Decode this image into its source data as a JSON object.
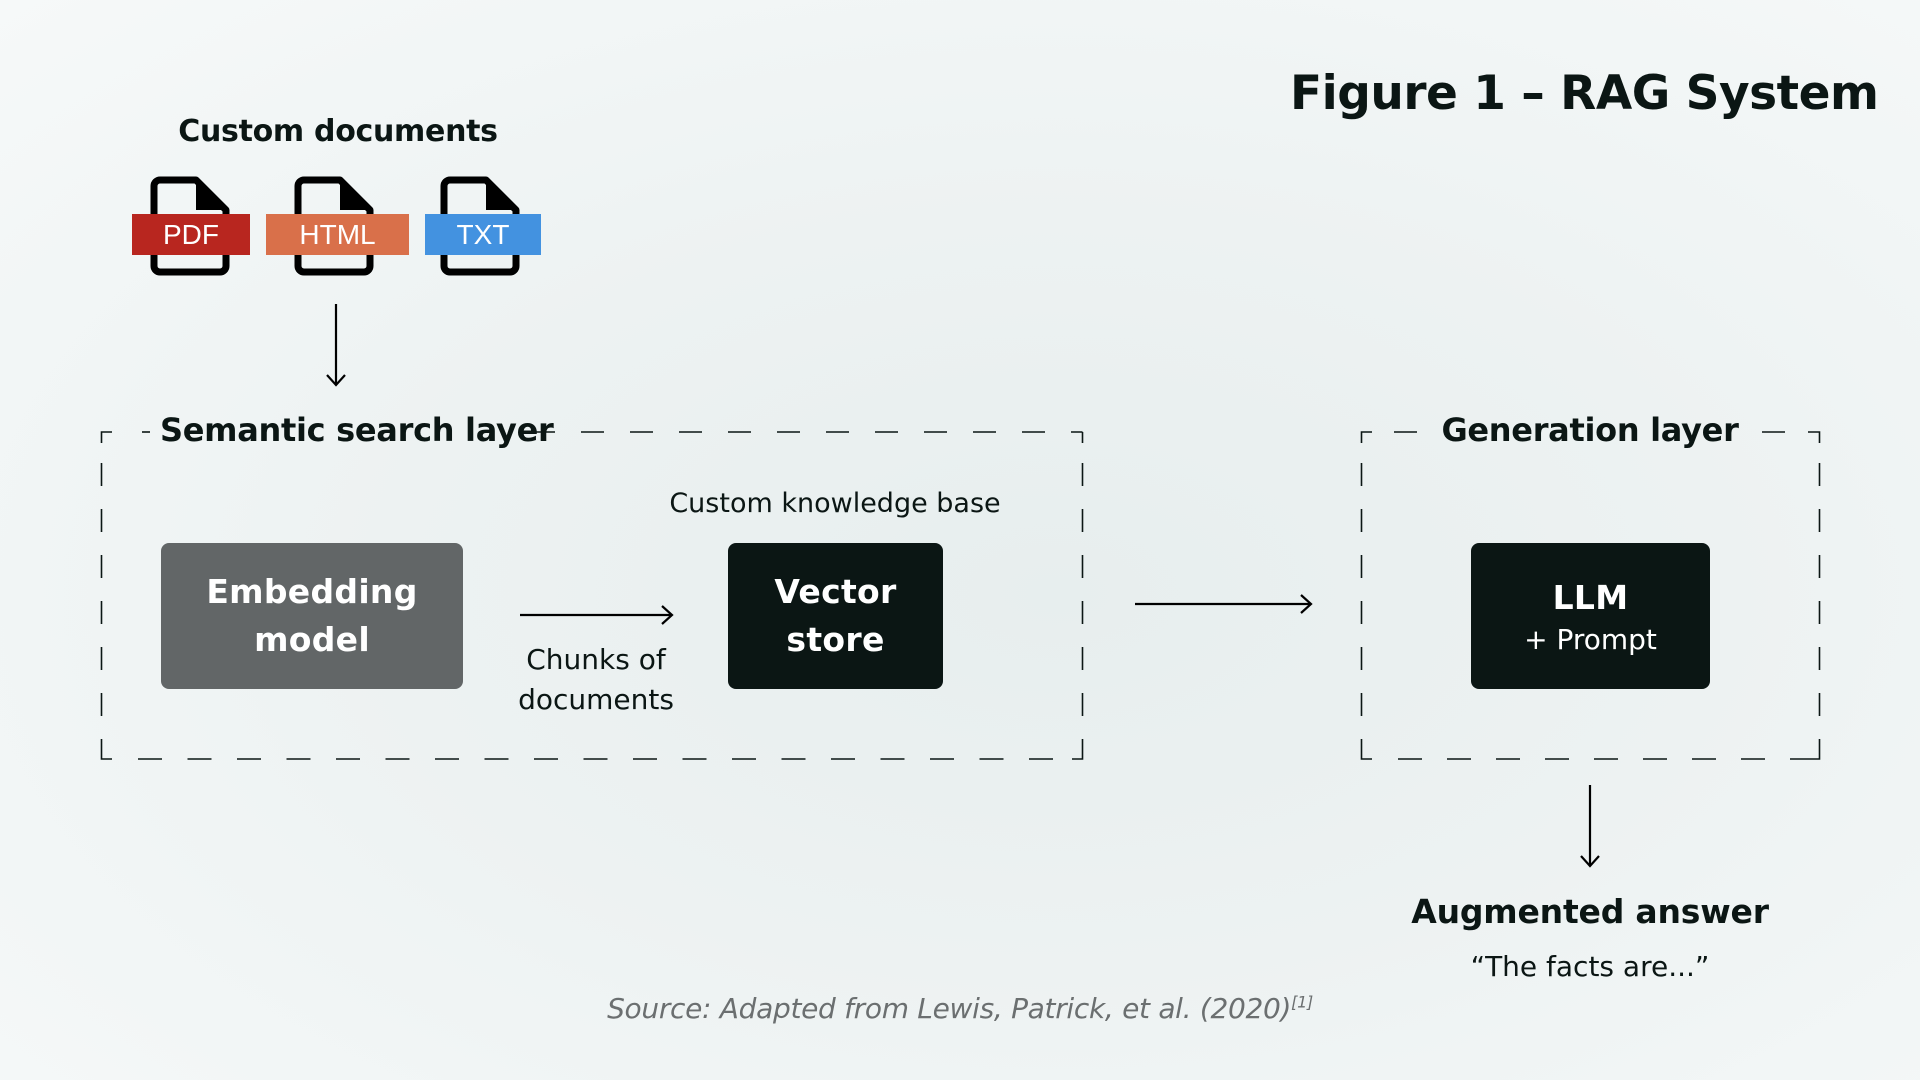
{
  "figure": {
    "title": "Figure 1 – RAG System",
    "source_prefix": "Source: Adapted from Lewis, Patrick, et al. (2020)",
    "source_ref": "[1]"
  },
  "custom_documents": {
    "title": "Custom documents",
    "files": [
      {
        "label": "PDF",
        "color": "#b8261f",
        "icon": "file-icon"
      },
      {
        "label": "HTML",
        "color": "#d9704a",
        "icon": "file-icon"
      },
      {
        "label": "TXT",
        "color": "#4392e0",
        "icon": "file-icon"
      }
    ]
  },
  "semantic_layer": {
    "label": "Semantic search layer",
    "knowledge_base_label": "Custom knowledge base",
    "embedding_box": {
      "line1": "Embedding",
      "line2": "model",
      "color": "#626667"
    },
    "chunks_label": {
      "line1": "Chunks of",
      "line2": "documents"
    },
    "vector_box": {
      "line1": "Vector",
      "line2": "store",
      "color": "#0b1614"
    }
  },
  "generation_layer": {
    "label": "Generation layer",
    "llm_box": {
      "line1": "LLM",
      "line2": "+ Prompt",
      "color": "#0b1614"
    }
  },
  "output": {
    "title": "Augmented answer",
    "example": "“The facts are...”"
  }
}
